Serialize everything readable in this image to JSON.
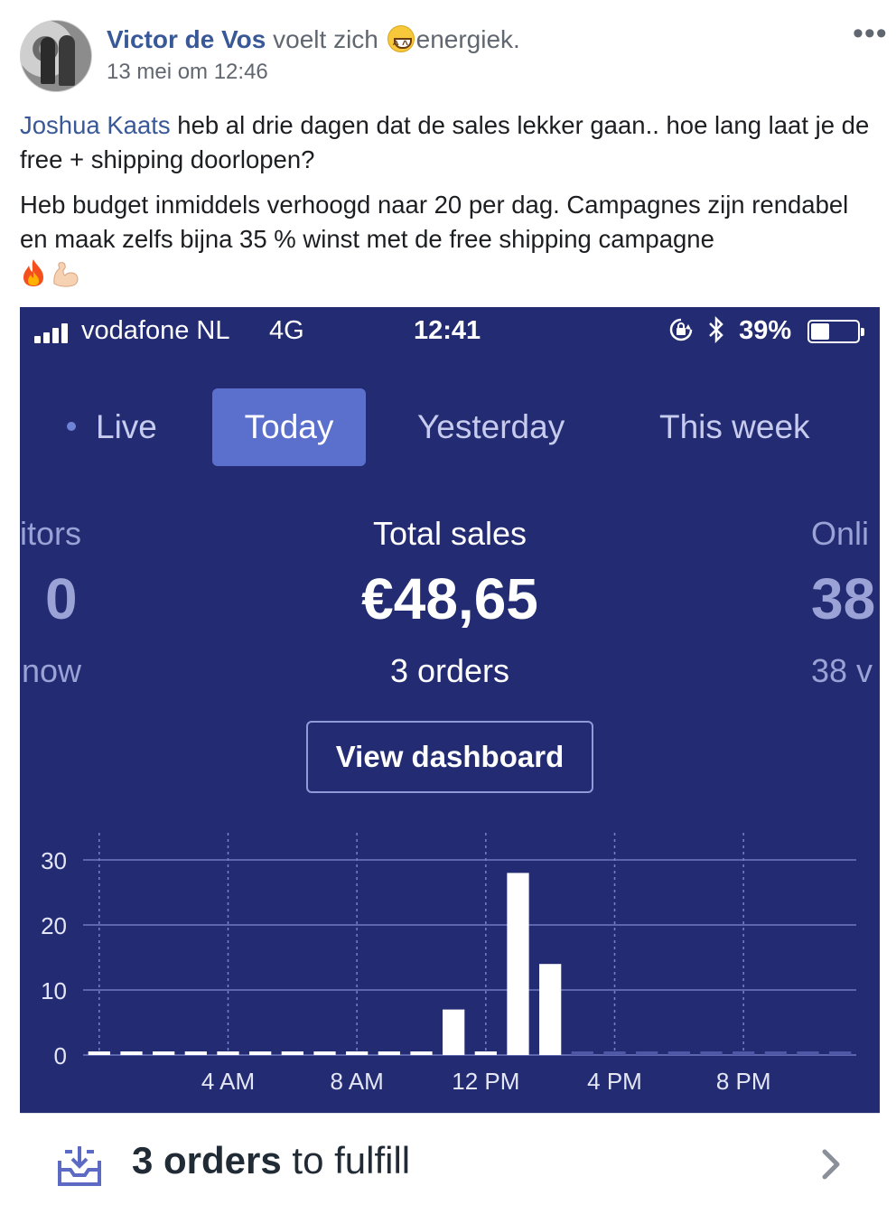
{
  "post": {
    "author": "Victor de Vos",
    "feeling_prefix": "voelt zich",
    "feeling": "energiek.",
    "timestamp": "13 mei om 12:46",
    "mention": "Joshua Kaats",
    "paragraph1_rest": " heb al drie dagen dat de sales lekker gaan.. hoe lang laat je de free + shipping doorlopen?",
    "paragraph2": "Heb budget inmiddels verhoogd naar 20 per dag. Campagnes zijn rendabel en maak zelfs bijna 35 % winst met de free shipping campagne",
    "more_label": "•••",
    "emoji_feeling": "grinning-squinting-face-icon",
    "emoji_end": [
      "fire-icon",
      "flexed-biceps-icon"
    ]
  },
  "phone": {
    "status": {
      "carrier": "vodafone NL",
      "network": "4G",
      "time": "12:41",
      "battery_text": "39%",
      "battery_level": 0.39,
      "icons": [
        "signal-bars-icon",
        "rotation-lock-icon",
        "bluetooth-icon",
        "battery-icon"
      ]
    },
    "tabs": [
      {
        "label": "Live",
        "active": false
      },
      {
        "label": "Today",
        "active": true
      },
      {
        "label": "Yesterday",
        "active": false
      },
      {
        "label": "This week",
        "active": false
      }
    ],
    "metrics": {
      "left_label": "itors",
      "left_value": "0",
      "left_sub": "now",
      "center_label": "Total sales",
      "center_value": "€48,65",
      "center_sub": "3 orders",
      "right_label": "Onli",
      "right_value": "38",
      "right_sub": "38 v"
    },
    "view_dashboard": "View dashboard",
    "fulfill": {
      "count_label": "3 orders",
      "rest_label": " to fulfill"
    }
  },
  "colors": {
    "facebook_link": "#385898",
    "shopify_navy": "#232c72",
    "active_tab": "#5b6fcc"
  },
  "chart_data": {
    "type": "bar",
    "x": [
      0,
      1,
      2,
      3,
      4,
      5,
      6,
      7,
      8,
      9,
      10,
      11,
      12,
      13,
      14,
      15,
      16,
      17,
      18,
      19,
      20,
      21,
      22,
      23
    ],
    "values": [
      0,
      0,
      0,
      0,
      0,
      0,
      0,
      0,
      0,
      0,
      0,
      7,
      0,
      28,
      14,
      0,
      0,
      0,
      0,
      0,
      0,
      0,
      0,
      0
    ],
    "xtick_labels": [
      "4 AM",
      "8 AM",
      "12 PM",
      "4 PM",
      "8 PM"
    ],
    "xtick_positions": [
      4,
      8,
      12,
      16,
      20
    ],
    "yticks": [
      0,
      10,
      20,
      30
    ],
    "ylim": [
      0,
      30
    ],
    "grid": true,
    "title": "",
    "xlabel": "",
    "ylabel": "",
    "current_hour": 12
  }
}
